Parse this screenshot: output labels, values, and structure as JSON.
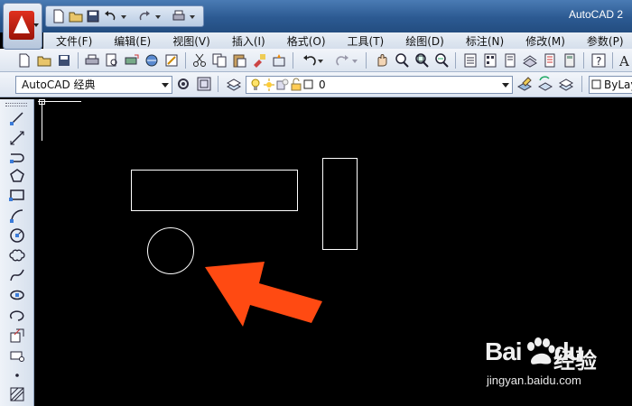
{
  "window": {
    "title": "AutoCAD 2"
  },
  "menu": [
    "文件(F)",
    "编辑(E)",
    "视图(V)",
    "插入(I)",
    "格式(O)",
    "工具(T)",
    "绘图(D)",
    "标注(N)",
    "修改(M)",
    "参数(P)"
  ],
  "toolbar2": {
    "workspace": "AutoCAD 经典",
    "layer_value": "0",
    "bylayer": "ByLay"
  },
  "quick_access_icons": [
    "new-icon",
    "open-icon",
    "save-icon",
    "undo-icon",
    "redo-icon",
    "print-icon"
  ],
  "watermark": {
    "brand": "Bai",
    "brand2": "du",
    "cn": "经验",
    "url": "jingyan.baidu.com"
  },
  "colors": {
    "arrow": "#ff4a12",
    "canvas": "#000000",
    "titlebar": "#2c5a92"
  }
}
